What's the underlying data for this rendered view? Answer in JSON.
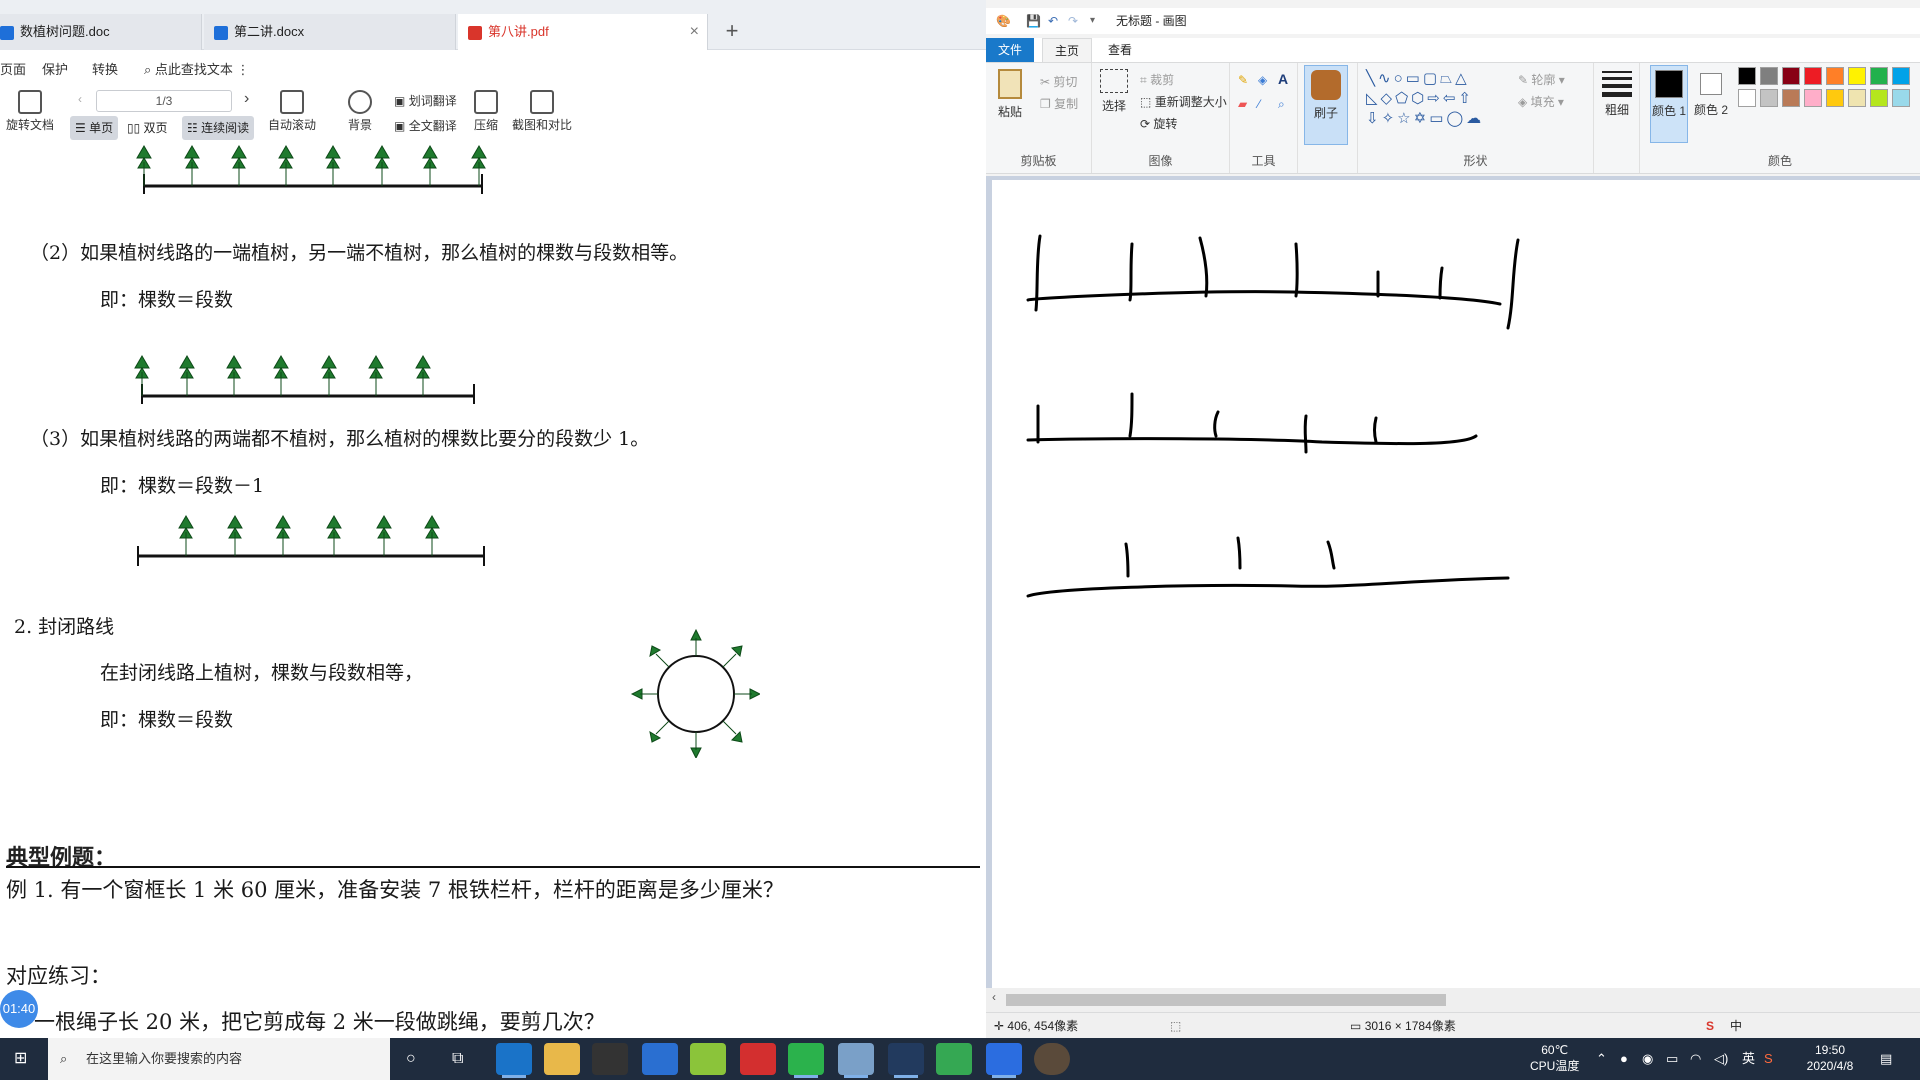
{
  "wps": {
    "tabs": [
      {
        "label": "数植树问题.doc",
        "icon_color": "#1e6fd9"
      },
      {
        "label": "第二讲.docx",
        "icon_color": "#1e6fd9"
      },
      {
        "label": "第八讲.pdf",
        "icon_color": "#d9352b"
      }
    ],
    "tab_close": "×",
    "tab_add": "+",
    "menu": [
      "页面",
      "保护",
      "转换",
      "点此查找文本"
    ],
    "toolbar": {
      "rotate": "旋转文档",
      "page_value": "1/3",
      "single": "单页",
      "double": "双页",
      "continuous": "连续阅读",
      "autoscroll": "自动滚动",
      "background": "背景",
      "word_translate": "划词翻译",
      "full_translate": "全文翻译",
      "compress": "压缩",
      "screenshot": "截图和对比"
    },
    "doc": {
      "p2": "（2）如果植树线路的一端植树，另一端不植树，那么植树的棵数与段数相等。",
      "p2_formula": "即：棵数＝段数",
      "p3": "（3）如果植树线路的两端都不植树，那么植树的棵数比要分的段数少 1。",
      "p3_formula": "即：棵数＝段数－1",
      "s2_title": "2. 封闭路线",
      "s2_text": "在封闭线路上植树，棵数与段数相等，",
      "s2_formula": "即：棵数＝段数",
      "examples_title": "典型例题：",
      "example1": "例 1. 有一个窗框长 1 米 60 厘米，准备安装 7 根铁栏杆，栏杆的距离是多少厘米？",
      "practice_title": "对应练习：",
      "practice1": "一根绳子长 20 米，把它剪成每 2 米一段做跳绳，要剪几次？"
    },
    "timer": "01:40"
  },
  "paint": {
    "title": "无标题 - 画图",
    "tabs": [
      "文件",
      "主页",
      "查看"
    ],
    "ribbon": {
      "paste": "粘贴",
      "cut": "剪切",
      "copy": "复制",
      "clipboard_group": "剪贴板",
      "select": "选择",
      "crop": "裁剪",
      "resize": "重新调整大小",
      "rotate": "旋转",
      "image_group": "图像",
      "tools_group": "工具",
      "brush": "刷子",
      "shapes_group": "形状",
      "outline": "轮廓",
      "fill": "填充",
      "size": "粗细",
      "color1": "颜色 1",
      "color2": "颜色 2",
      "colors_group": "颜色"
    },
    "palette": [
      "#000000",
      "#7f7f7f",
      "#880015",
      "#ed1c24",
      "#ff7f27",
      "#fff200",
      "#22b14c",
      "#00a2e8",
      "#ffffff",
      "#c3c3c3",
      "#b97a57",
      "#ffaec9",
      "#ffc90e",
      "#efe4b0",
      "#b5e61d",
      "#99d9ea"
    ],
    "status": {
      "cursor": "406, 454像素",
      "canvas_size": "3016 × 1784像素"
    }
  },
  "taskbar": {
    "search_placeholder": "在这里输入你要搜索的内容",
    "temp": "60℃",
    "temp_label": "CPU温度",
    "time": "19:50",
    "date": "2020/4/8",
    "ime": "中"
  }
}
